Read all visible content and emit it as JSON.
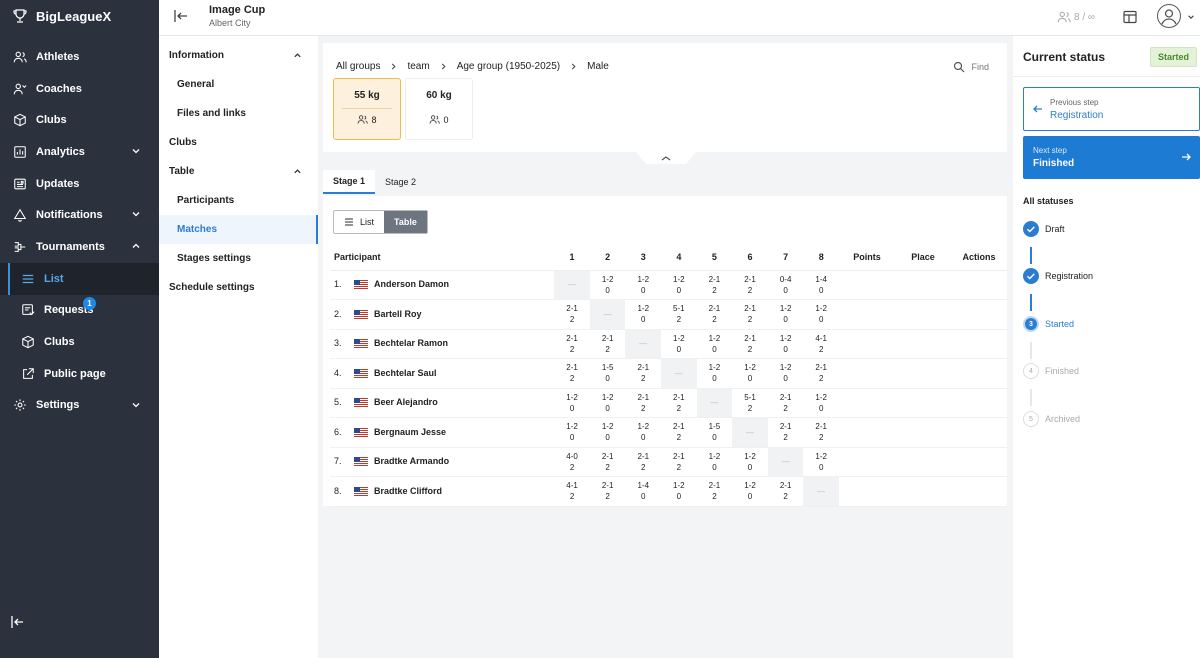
{
  "brand": {
    "name": "BigLeagueX"
  },
  "sidebar": {
    "items": [
      {
        "label": "Athletes",
        "icon": "users-icon",
        "expandable": false
      },
      {
        "label": "Coaches",
        "icon": "coach-icon",
        "expandable": false
      },
      {
        "label": "Clubs",
        "icon": "cube-icon",
        "expandable": false
      },
      {
        "label": "Analytics",
        "icon": "chart-icon",
        "expandable": true
      },
      {
        "label": "Updates",
        "icon": "news-icon",
        "expandable": false
      },
      {
        "label": "Notifications",
        "icon": "bell-icon",
        "expandable": true
      },
      {
        "label": "Tournaments",
        "icon": "bracket-icon",
        "expandable": true
      }
    ],
    "tournament_children": [
      {
        "label": "List",
        "icon": "list-icon"
      },
      {
        "label": "Requests",
        "icon": "requests-icon",
        "badge": "1"
      },
      {
        "label": "Clubs",
        "icon": "cube-icon"
      },
      {
        "label": "Public page",
        "icon": "external-link-icon"
      }
    ],
    "settings": {
      "label": "Settings",
      "icon": "gear-icon"
    }
  },
  "topbar": {
    "title": "Image Cup",
    "subtitle": "Albert City",
    "seats": "8 / ∞"
  },
  "subnav": {
    "information": "Information",
    "general": "General",
    "files": "Files and links",
    "clubs": "Clubs",
    "table": "Table",
    "participants": "Participants",
    "matches": "Matches",
    "stages_settings": "Stages settings",
    "schedule_settings": "Schedule settings"
  },
  "breadcrumb": [
    "All groups",
    "team",
    "Age group (1950-2025)",
    "Male"
  ],
  "find_label": "Find",
  "weight_classes": [
    {
      "weight": "55 kg",
      "count": "8"
    },
    {
      "weight": "60 kg",
      "count": "0"
    }
  ],
  "stage_tabs": [
    "Stage 1",
    "Stage 2"
  ],
  "view_toggle": {
    "list": "List",
    "table": "Table"
  },
  "table": {
    "headers": {
      "participant": "Participant",
      "cols": [
        "1",
        "2",
        "3",
        "4",
        "5",
        "6",
        "7",
        "8"
      ],
      "points": "Points",
      "place": "Place",
      "actions": "Actions"
    },
    "rows": [
      {
        "idx": "1.",
        "name": "Anderson Damon",
        "cells": [
          [
            "—",
            ""
          ],
          [
            "1-2",
            "0"
          ],
          [
            "1-2",
            "0"
          ],
          [
            "1-2",
            "0"
          ],
          [
            "2-1",
            "2"
          ],
          [
            "2-1",
            "2"
          ],
          [
            "0-4",
            "0"
          ],
          [
            "1-4",
            "0"
          ]
        ]
      },
      {
        "idx": "2.",
        "name": "Bartell Roy",
        "cells": [
          [
            "2-1",
            "2"
          ],
          [
            "—",
            ""
          ],
          [
            "1-2",
            "0"
          ],
          [
            "5-1",
            "2"
          ],
          [
            "2-1",
            "2"
          ],
          [
            "2-1",
            "2"
          ],
          [
            "1-2",
            "0"
          ],
          [
            "1-2",
            "0"
          ]
        ]
      },
      {
        "idx": "3.",
        "name": "Bechtelar Ramon",
        "cells": [
          [
            "2-1",
            "2"
          ],
          [
            "2-1",
            "2"
          ],
          [
            "—",
            ""
          ],
          [
            "1-2",
            "0"
          ],
          [
            "1-2",
            "0"
          ],
          [
            "2-1",
            "2"
          ],
          [
            "1-2",
            "0"
          ],
          [
            "4-1",
            "2"
          ]
        ]
      },
      {
        "idx": "4.",
        "name": "Bechtelar Saul",
        "cells": [
          [
            "2-1",
            "2"
          ],
          [
            "1-5",
            "0"
          ],
          [
            "2-1",
            "2"
          ],
          [
            "—",
            ""
          ],
          [
            "1-2",
            "0"
          ],
          [
            "1-2",
            "0"
          ],
          [
            "1-2",
            "0"
          ],
          [
            "2-1",
            "2"
          ]
        ]
      },
      {
        "idx": "5.",
        "name": "Beer Alejandro",
        "cells": [
          [
            "1-2",
            "0"
          ],
          [
            "1-2",
            "0"
          ],
          [
            "2-1",
            "2"
          ],
          [
            "2-1",
            "2"
          ],
          [
            "—",
            ""
          ],
          [
            "5-1",
            "2"
          ],
          [
            "2-1",
            "2"
          ],
          [
            "1-2",
            "0"
          ]
        ]
      },
      {
        "idx": "6.",
        "name": "Bergnaum Jesse",
        "cells": [
          [
            "1-2",
            "0"
          ],
          [
            "1-2",
            "0"
          ],
          [
            "1-2",
            "0"
          ],
          [
            "2-1",
            "2"
          ],
          [
            "1-5",
            "0"
          ],
          [
            "—",
            ""
          ],
          [
            "2-1",
            "2"
          ],
          [
            "2-1",
            "2"
          ]
        ]
      },
      {
        "idx": "7.",
        "name": "Bradtke Armando",
        "cells": [
          [
            "4-0",
            "2"
          ],
          [
            "2-1",
            "2"
          ],
          [
            "2-1",
            "2"
          ],
          [
            "2-1",
            "2"
          ],
          [
            "1-2",
            "0"
          ],
          [
            "1-2",
            "0"
          ],
          [
            "—",
            ""
          ],
          [
            "1-2",
            "0"
          ]
        ]
      },
      {
        "idx": "8.",
        "name": "Bradtke Clifford",
        "cells": [
          [
            "4-1",
            "2"
          ],
          [
            "2-1",
            "2"
          ],
          [
            "1-4",
            "0"
          ],
          [
            "1-2",
            "0"
          ],
          [
            "2-1",
            "2"
          ],
          [
            "1-2",
            "0"
          ],
          [
            "2-1",
            "2"
          ],
          [
            "—",
            ""
          ]
        ]
      }
    ]
  },
  "status_panel": {
    "title": "Current status",
    "badge": "Started",
    "prev_caption": "Previous step",
    "prev_value": "Registration",
    "next_caption": "Next step",
    "next_value": "Finished",
    "all_statuses": "All statuses",
    "steps": [
      {
        "num": "1",
        "label": "Draft",
        "state": "done"
      },
      {
        "num": "2",
        "label": "Registration",
        "state": "done"
      },
      {
        "num": "3",
        "label": "Started",
        "state": "current"
      },
      {
        "num": "4",
        "label": "Finished",
        "state": "todo"
      },
      {
        "num": "5",
        "label": "Archived",
        "state": "todo"
      }
    ]
  },
  "colors": {
    "sidebar_bg": "#2c323d",
    "accent": "#2c7dd1",
    "next_btn": "#1e7bd3",
    "badge_bg": "#e3f2d9",
    "selected_card": "#fdf1dd"
  }
}
